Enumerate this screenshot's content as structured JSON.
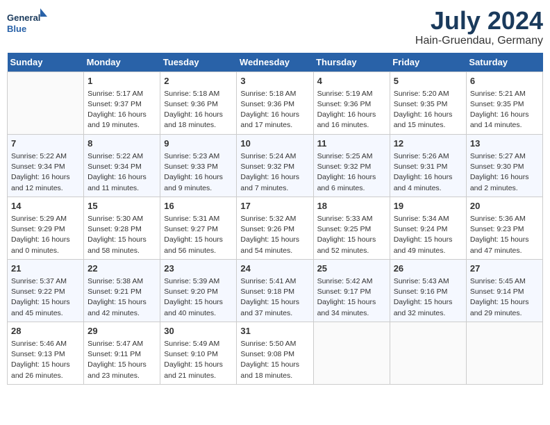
{
  "header": {
    "logo_line1": "General",
    "logo_line2": "Blue",
    "month": "July 2024",
    "location": "Hain-Gruendau, Germany"
  },
  "weekdays": [
    "Sunday",
    "Monday",
    "Tuesday",
    "Wednesday",
    "Thursday",
    "Friday",
    "Saturday"
  ],
  "weeks": [
    [
      {
        "day": "",
        "info": ""
      },
      {
        "day": "1",
        "info": "Sunrise: 5:17 AM\nSunset: 9:37 PM\nDaylight: 16 hours\nand 19 minutes."
      },
      {
        "day": "2",
        "info": "Sunrise: 5:18 AM\nSunset: 9:36 PM\nDaylight: 16 hours\nand 18 minutes."
      },
      {
        "day": "3",
        "info": "Sunrise: 5:18 AM\nSunset: 9:36 PM\nDaylight: 16 hours\nand 17 minutes."
      },
      {
        "day": "4",
        "info": "Sunrise: 5:19 AM\nSunset: 9:36 PM\nDaylight: 16 hours\nand 16 minutes."
      },
      {
        "day": "5",
        "info": "Sunrise: 5:20 AM\nSunset: 9:35 PM\nDaylight: 16 hours\nand 15 minutes."
      },
      {
        "day": "6",
        "info": "Sunrise: 5:21 AM\nSunset: 9:35 PM\nDaylight: 16 hours\nand 14 minutes."
      }
    ],
    [
      {
        "day": "7",
        "info": "Sunrise: 5:22 AM\nSunset: 9:34 PM\nDaylight: 16 hours\nand 12 minutes."
      },
      {
        "day": "8",
        "info": "Sunrise: 5:22 AM\nSunset: 9:34 PM\nDaylight: 16 hours\nand 11 minutes."
      },
      {
        "day": "9",
        "info": "Sunrise: 5:23 AM\nSunset: 9:33 PM\nDaylight: 16 hours\nand 9 minutes."
      },
      {
        "day": "10",
        "info": "Sunrise: 5:24 AM\nSunset: 9:32 PM\nDaylight: 16 hours\nand 7 minutes."
      },
      {
        "day": "11",
        "info": "Sunrise: 5:25 AM\nSunset: 9:32 PM\nDaylight: 16 hours\nand 6 minutes."
      },
      {
        "day": "12",
        "info": "Sunrise: 5:26 AM\nSunset: 9:31 PM\nDaylight: 16 hours\nand 4 minutes."
      },
      {
        "day": "13",
        "info": "Sunrise: 5:27 AM\nSunset: 9:30 PM\nDaylight: 16 hours\nand 2 minutes."
      }
    ],
    [
      {
        "day": "14",
        "info": "Sunrise: 5:29 AM\nSunset: 9:29 PM\nDaylight: 16 hours\nand 0 minutes."
      },
      {
        "day": "15",
        "info": "Sunrise: 5:30 AM\nSunset: 9:28 PM\nDaylight: 15 hours\nand 58 minutes."
      },
      {
        "day": "16",
        "info": "Sunrise: 5:31 AM\nSunset: 9:27 PM\nDaylight: 15 hours\nand 56 minutes."
      },
      {
        "day": "17",
        "info": "Sunrise: 5:32 AM\nSunset: 9:26 PM\nDaylight: 15 hours\nand 54 minutes."
      },
      {
        "day": "18",
        "info": "Sunrise: 5:33 AM\nSunset: 9:25 PM\nDaylight: 15 hours\nand 52 minutes."
      },
      {
        "day": "19",
        "info": "Sunrise: 5:34 AM\nSunset: 9:24 PM\nDaylight: 15 hours\nand 49 minutes."
      },
      {
        "day": "20",
        "info": "Sunrise: 5:36 AM\nSunset: 9:23 PM\nDaylight: 15 hours\nand 47 minutes."
      }
    ],
    [
      {
        "day": "21",
        "info": "Sunrise: 5:37 AM\nSunset: 9:22 PM\nDaylight: 15 hours\nand 45 minutes."
      },
      {
        "day": "22",
        "info": "Sunrise: 5:38 AM\nSunset: 9:21 PM\nDaylight: 15 hours\nand 42 minutes."
      },
      {
        "day": "23",
        "info": "Sunrise: 5:39 AM\nSunset: 9:20 PM\nDaylight: 15 hours\nand 40 minutes."
      },
      {
        "day": "24",
        "info": "Sunrise: 5:41 AM\nSunset: 9:18 PM\nDaylight: 15 hours\nand 37 minutes."
      },
      {
        "day": "25",
        "info": "Sunrise: 5:42 AM\nSunset: 9:17 PM\nDaylight: 15 hours\nand 34 minutes."
      },
      {
        "day": "26",
        "info": "Sunrise: 5:43 AM\nSunset: 9:16 PM\nDaylight: 15 hours\nand 32 minutes."
      },
      {
        "day": "27",
        "info": "Sunrise: 5:45 AM\nSunset: 9:14 PM\nDaylight: 15 hours\nand 29 minutes."
      }
    ],
    [
      {
        "day": "28",
        "info": "Sunrise: 5:46 AM\nSunset: 9:13 PM\nDaylight: 15 hours\nand 26 minutes."
      },
      {
        "day": "29",
        "info": "Sunrise: 5:47 AM\nSunset: 9:11 PM\nDaylight: 15 hours\nand 23 minutes."
      },
      {
        "day": "30",
        "info": "Sunrise: 5:49 AM\nSunset: 9:10 PM\nDaylight: 15 hours\nand 21 minutes."
      },
      {
        "day": "31",
        "info": "Sunrise: 5:50 AM\nSunset: 9:08 PM\nDaylight: 15 hours\nand 18 minutes."
      },
      {
        "day": "",
        "info": ""
      },
      {
        "day": "",
        "info": ""
      },
      {
        "day": "",
        "info": ""
      }
    ]
  ]
}
